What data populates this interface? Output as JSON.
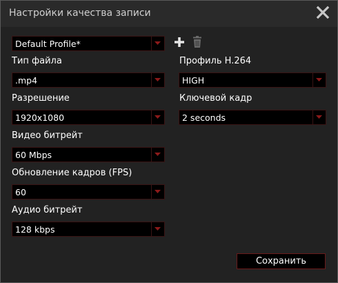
{
  "window": {
    "title": "Настройки качества записи"
  },
  "profile": {
    "selected": "Default Profile*"
  },
  "left": {
    "file_type": {
      "label": "Тип файла",
      "value": ".mp4"
    },
    "resolution": {
      "label": "Разрешение",
      "value": "1920x1080"
    },
    "video_bitrate": {
      "label": "Видео битрейт",
      "value": "60 Mbps"
    },
    "fps": {
      "label": "Обновление кадров (FPS)",
      "value": "60"
    },
    "audio_bitrate": {
      "label": "Аудио битрейт",
      "value": "128 kbps"
    }
  },
  "right": {
    "h264_profile": {
      "label": "Профиль H.264",
      "value": "HIGH"
    },
    "keyframe": {
      "label": "Ключевой кадр",
      "value": "2 seconds"
    }
  },
  "buttons": {
    "save_label": "Сохранить"
  },
  "icons": {
    "close": "close-icon",
    "add": "plus-icon",
    "delete": "trash-icon",
    "dropdown": "chevron-down-icon"
  },
  "colors": {
    "background": "#222222",
    "field_background": "#000000",
    "accent": "#8b1a1a",
    "text": "#ffffff"
  }
}
